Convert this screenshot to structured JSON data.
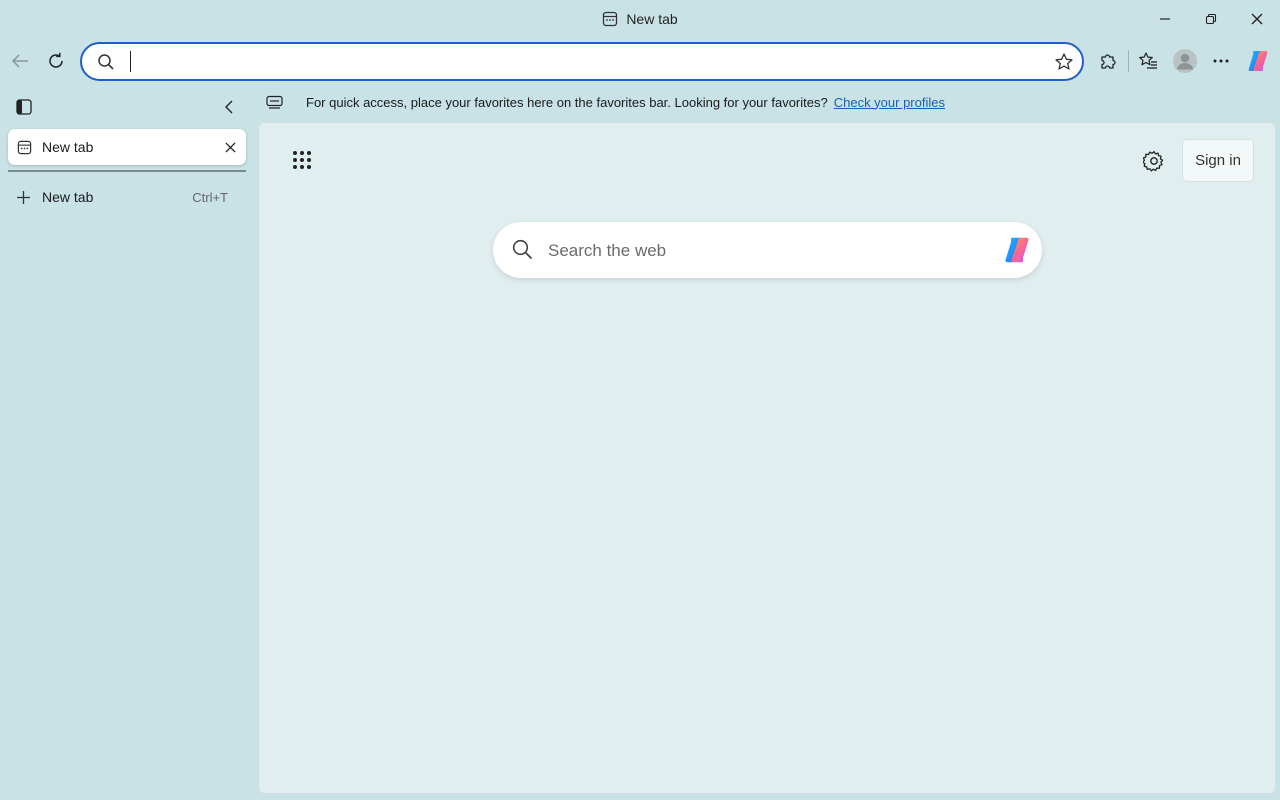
{
  "window": {
    "title": "New tab"
  },
  "toolbar": {
    "address_placeholder": ""
  },
  "sidebar": {
    "tabs": [
      {
        "label": "New tab"
      }
    ],
    "new_tab": {
      "label": "New tab",
      "shortcut": "Ctrl+T"
    }
  },
  "favorites_bar": {
    "message": "For quick access, place your favorites here on the favorites bar. Looking for your favorites?",
    "link": "Check your profiles"
  },
  "content": {
    "sign_in_label": "Sign in",
    "search_placeholder": "Search the web"
  },
  "colors": {
    "accent": "#1f5fc9",
    "link": "#1a5fb4",
    "background": "#c9e2e6",
    "content_background": "#e1eef0"
  }
}
